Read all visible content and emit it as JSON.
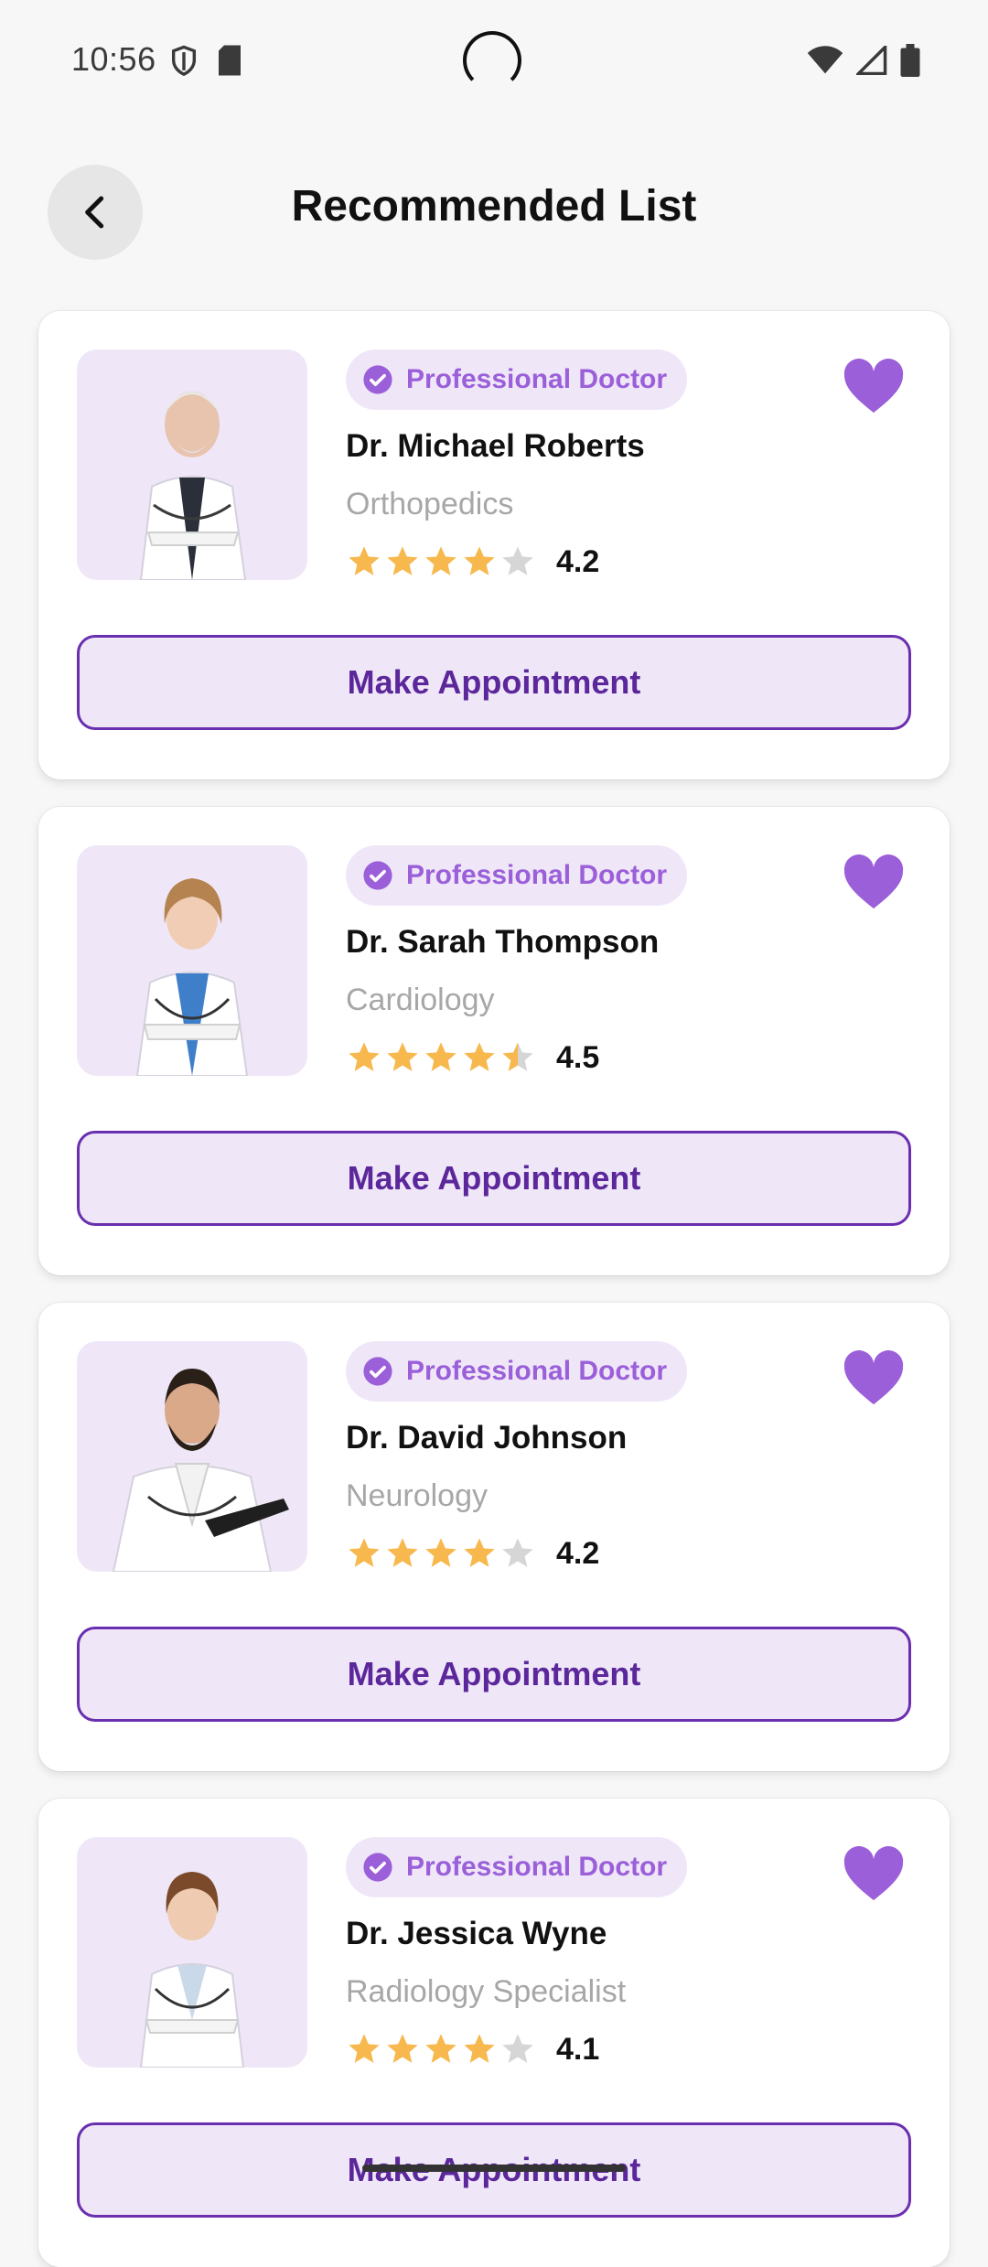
{
  "status_bar": {
    "time": "10:56"
  },
  "header": {
    "title": "Recommended List"
  },
  "colors": {
    "accent": "#9b5fd9",
    "accent_dark": "#5b279b",
    "tint": "#efe7f8",
    "star": "#f7b84e",
    "star_empty": "#d6d6d6"
  },
  "doctors": [
    {
      "badge": "Professional Doctor",
      "name": "Dr. Michael Roberts",
      "specialty": "Orthopedics",
      "rating": "4.2",
      "button": "Make Appointment"
    },
    {
      "badge": "Professional Doctor",
      "name": "Dr. Sarah Thompson",
      "specialty": "Cardiology",
      "rating": "4.5",
      "button": "Make Appointment"
    },
    {
      "badge": "Professional Doctor",
      "name": "Dr. David Johnson",
      "specialty": "Neurology",
      "rating": "4.2",
      "button": "Make Appointment"
    },
    {
      "badge": "Professional Doctor",
      "name": "Dr. Jessica Wyne",
      "specialty": "Radiology Specialist",
      "rating": "4.1",
      "button": "Make Appointment"
    }
  ]
}
